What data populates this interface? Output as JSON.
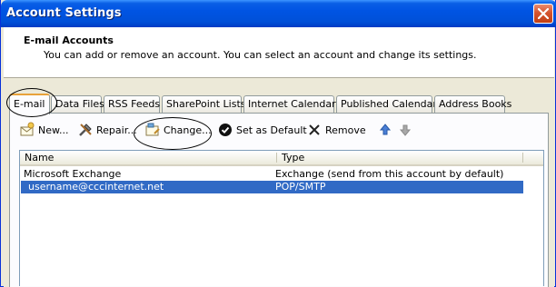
{
  "window": {
    "title": "Account Settings",
    "close_icon": "close-icon"
  },
  "header": {
    "title": "E-mail Accounts",
    "description": "You can add or remove an account. You can select an account and change its settings."
  },
  "tabs": [
    {
      "label": "E-mail",
      "active": true
    },
    {
      "label": "Data Files"
    },
    {
      "label": "RSS Feeds"
    },
    {
      "label": "SharePoint Lists"
    },
    {
      "label": "Internet Calendars"
    },
    {
      "label": "Published Calendars"
    },
    {
      "label": "Address Books"
    }
  ],
  "toolbar": {
    "new_label": "New...",
    "repair_label": "Repair...",
    "change_label": "Change...",
    "default_label": "Set as Default",
    "remove_label": "Remove",
    "up_icon": "arrow-up-icon",
    "down_icon": "arrow-down-icon"
  },
  "list": {
    "columns": [
      "Name",
      "Type"
    ],
    "rows": [
      {
        "name": "Microsoft Exchange",
        "type": "Exchange (send from this account by default)",
        "selected": false
      },
      {
        "name": "username@cccinternet.net",
        "type": "POP/SMTP",
        "selected": true
      }
    ]
  },
  "colors": {
    "titlebar": "#0054e3",
    "selection": "#316ac5",
    "dialog_bg": "#ece9d8",
    "tab_highlight": "#e8a23a"
  }
}
